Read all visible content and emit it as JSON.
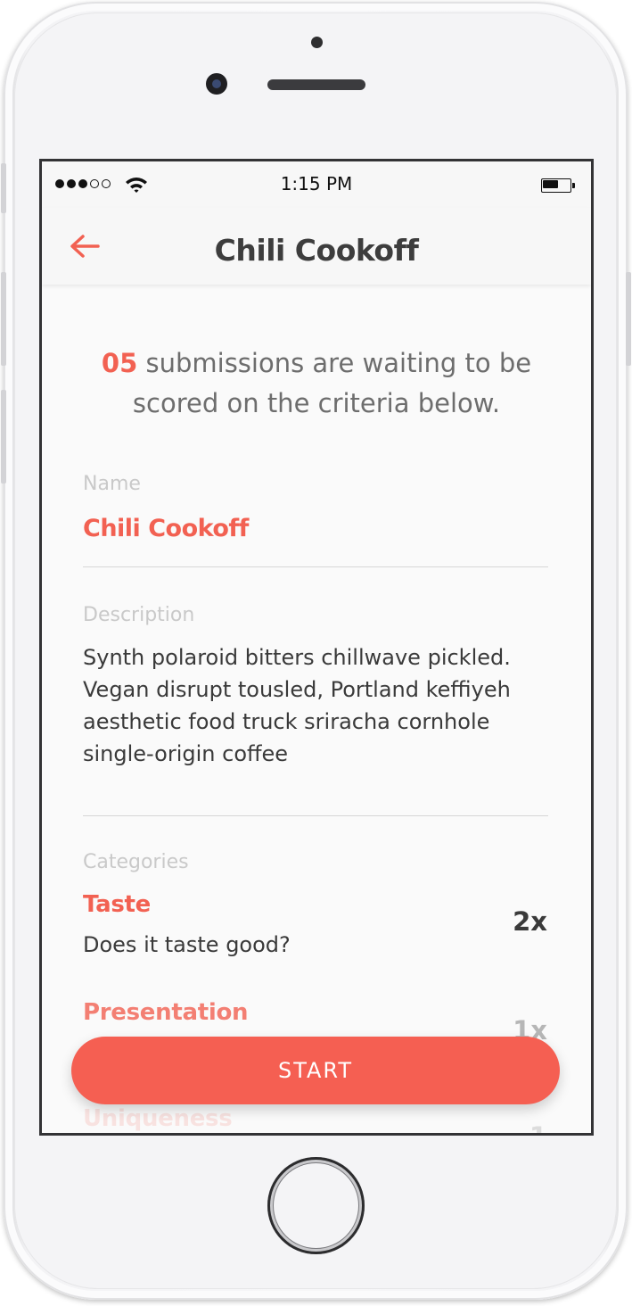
{
  "status_bar": {
    "time": "1:15 PM",
    "signal_bars_filled": 3,
    "signal_bars_total": 5,
    "battery_level": 0.55
  },
  "nav": {
    "title": "Chili Cookoff",
    "back_icon": "arrow-left-icon"
  },
  "intro": {
    "count": "05",
    "text": "submissions are waiting to be scored on the criteria below."
  },
  "fields": {
    "name_label": "Name",
    "name_value": "Chili Cookoff",
    "description_label": "Description",
    "description_value": "Synth polaroid bitters chillwave pickled. Vegan disrupt tousled, Portland keffiyeh aesthetic food truck sriracha cornhole single-origin coffee",
    "categories_label": "Categories"
  },
  "categories": [
    {
      "name": "Taste",
      "description": "Does it taste good?",
      "weight": "2x"
    },
    {
      "name": "Presentation",
      "description": "",
      "weight": "1x"
    },
    {
      "name": "Uniqueness",
      "description": "",
      "weight": "1"
    }
  ],
  "actions": {
    "start_label": "START"
  },
  "colors": {
    "accent": "#f26152",
    "button": "#f55f52",
    "text_dark": "#3a3a3a",
    "label_gray": "#c9c9c9"
  }
}
